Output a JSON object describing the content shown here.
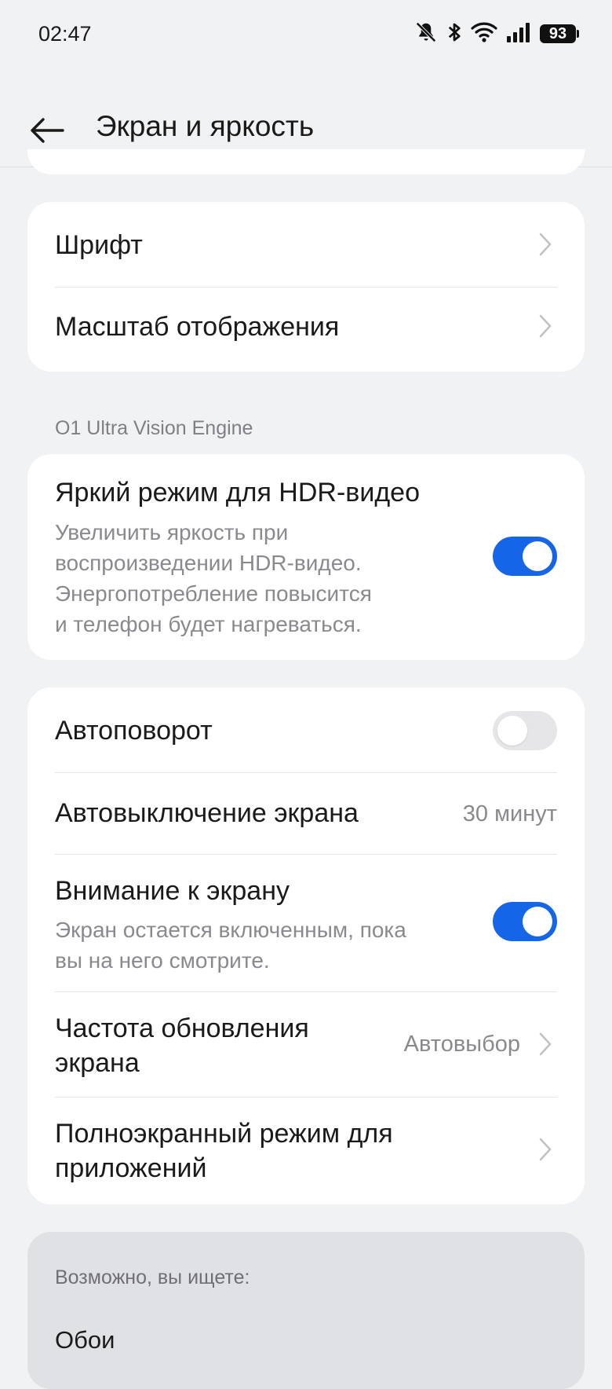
{
  "status_bar": {
    "time": "02:47",
    "battery": "93",
    "icons": [
      "bell-muted-icon",
      "bluetooth-icon",
      "wifi-icon",
      "signal-icon",
      "battery-icon"
    ]
  },
  "header": {
    "title": "Экран и яркость"
  },
  "group1": {
    "font_label": "Шрифт",
    "scale_label": "Масштаб отображения"
  },
  "section": {
    "label": "O1 Ultra Vision Engine"
  },
  "hdr": {
    "title": "Яркий режим для HDR-видео",
    "sub1": "Увеличить яркость при",
    "sub2": "воспроизведении HDR-видео.",
    "sub3": "Энергопотребление повысится",
    "sub4": "и телефон будет нагреваться.",
    "enabled": true
  },
  "group3": {
    "autorotate_label": "Автоповорот",
    "autorotate_enabled": false,
    "screen_timeout_label": "Автовыключение экрана",
    "screen_timeout_value": "30 минут",
    "attention_title": "Внимание к экрану",
    "attention_sub1": "Экран остается включенным, пока",
    "attention_sub2": "вы на него смотрите.",
    "attention_enabled": true,
    "refresh_title1": "Частота обновления",
    "refresh_title2": "экрана",
    "refresh_value": "Автовыбор",
    "fullscreen_title1": "Полноэкранный режим для",
    "fullscreen_title2": "приложений"
  },
  "suggestions": {
    "label": "Возможно, вы ищете:",
    "item1": "Обои"
  },
  "colors": {
    "accent": "#1565e8",
    "background": "#f1f2f4",
    "card": "#ffffff"
  }
}
